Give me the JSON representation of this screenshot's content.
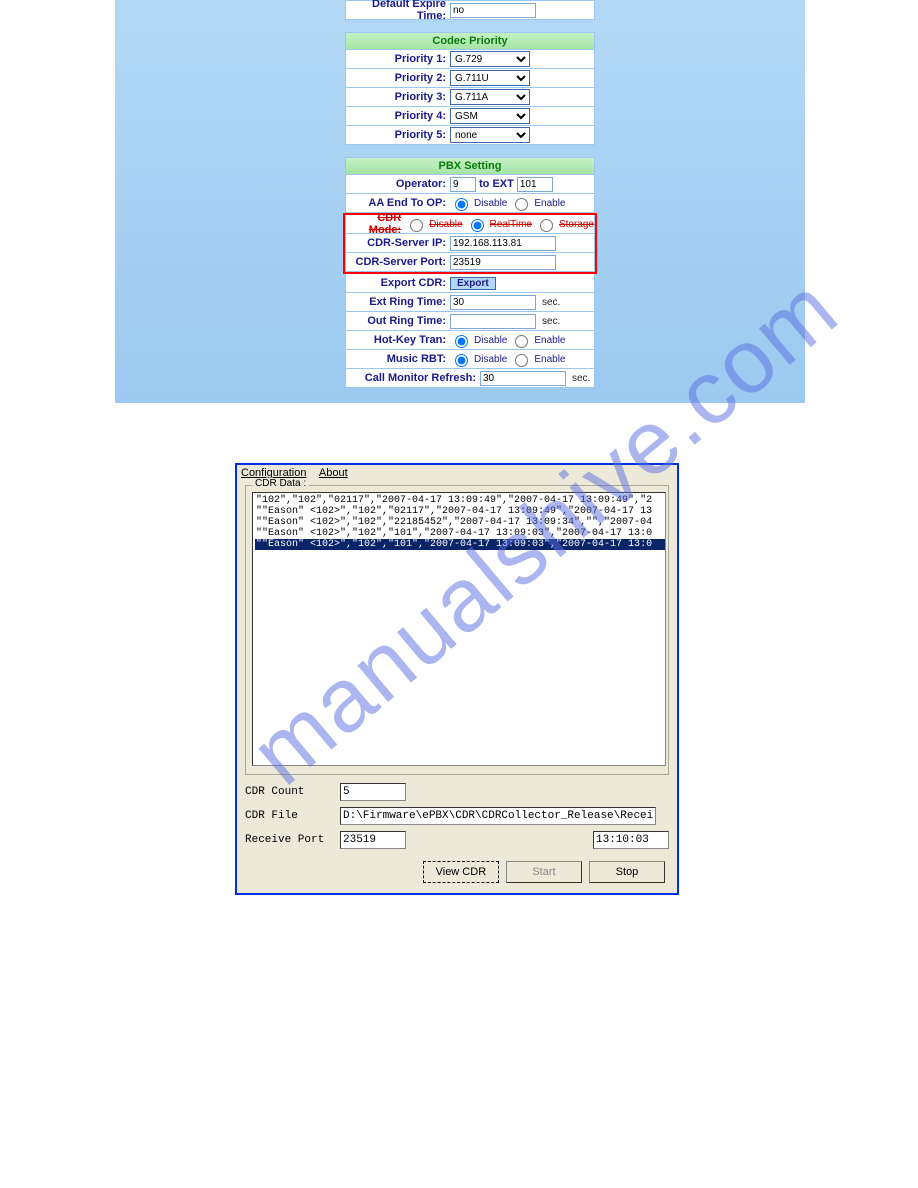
{
  "watermark": "manualshive.com",
  "web": {
    "default_expire": {
      "label": "Default Expire Time:",
      "value": "no"
    },
    "codec_priority_title": "Codec Priority",
    "priorities": [
      {
        "label": "Priority 1:",
        "value": "G.729"
      },
      {
        "label": "Priority 2:",
        "value": "G.711U"
      },
      {
        "label": "Priority 3:",
        "value": "G.711A"
      },
      {
        "label": "Priority 4:",
        "value": "GSM"
      },
      {
        "label": "Priority 5:",
        "value": "none"
      }
    ],
    "pbx_title": "PBX Setting",
    "operator": {
      "label": "Operator:",
      "v1": "9",
      "mid": "to EXT",
      "v2": "101"
    },
    "aa_end": {
      "label": "AA End To OP:",
      "opt1": "Disable",
      "opt2": "Enable"
    },
    "cdr_mode": {
      "label": "CDR Mode:",
      "opt1": "Disable",
      "opt2": "RealTime",
      "opt3": "Storage"
    },
    "cdr_ip": {
      "label": "CDR-Server IP:",
      "value": "192.168.113.81"
    },
    "cdr_port": {
      "label": "CDR-Server Port:",
      "value": "23519"
    },
    "export_cdr": {
      "label": "Export CDR:",
      "btn": "Export"
    },
    "ext_ring": {
      "label": "Ext Ring Time:",
      "value": "30",
      "unit": "sec."
    },
    "out_ring": {
      "label": "Out Ring Time:",
      "value": "",
      "unit": "sec."
    },
    "hotkey": {
      "label": "Hot-Key Tran:",
      "opt1": "Disable",
      "opt2": "Enable"
    },
    "music_rbt": {
      "label": "Music RBT:",
      "opt1": "Disable",
      "opt2": "Enable"
    },
    "call_monitor": {
      "label": "Call Monitor Refresh:",
      "value": "30",
      "unit": "sec."
    }
  },
  "win": {
    "menu": {
      "config": "Configuration",
      "about": "About"
    },
    "group_title": "CDR Data :",
    "lines": [
      "\"102\",\"102\",\"02117\",\"2007-04-17 13:09:49\",\"2007-04-17 13:09:49\",\"2",
      "\"\"Eason\" <102>\",\"102\",\"02117\",\"2007-04-17 13:09:49\",\"2007-04-17 13",
      "\"\"Eason\" <102>\",\"102\",\"22185452\",\"2007-04-17 13:09:34\",\"\",\"2007-04",
      "\"\"Eason\" <102>\",\"102\",\"101\",\"2007-04-17 13:09:03\",\"2007-04-17 13:0",
      "\"\"Eason\" <102>\",\"102\",\"101\",\"2007-04-17 13:09:03\",\"2007-04-17 13:0"
    ],
    "cdr_count": {
      "label": "CDR Count",
      "value": "5"
    },
    "cdr_file": {
      "label": "CDR File",
      "value": "D:\\Firmware\\ePBX\\CDR\\CDRCollector_Release\\ReceiveD"
    },
    "receive_port": {
      "label": "Receive Port",
      "value": "23519",
      "time": "13:10:03"
    },
    "buttons": {
      "view": "View CDR",
      "start": "Start",
      "stop": "Stop"
    }
  }
}
